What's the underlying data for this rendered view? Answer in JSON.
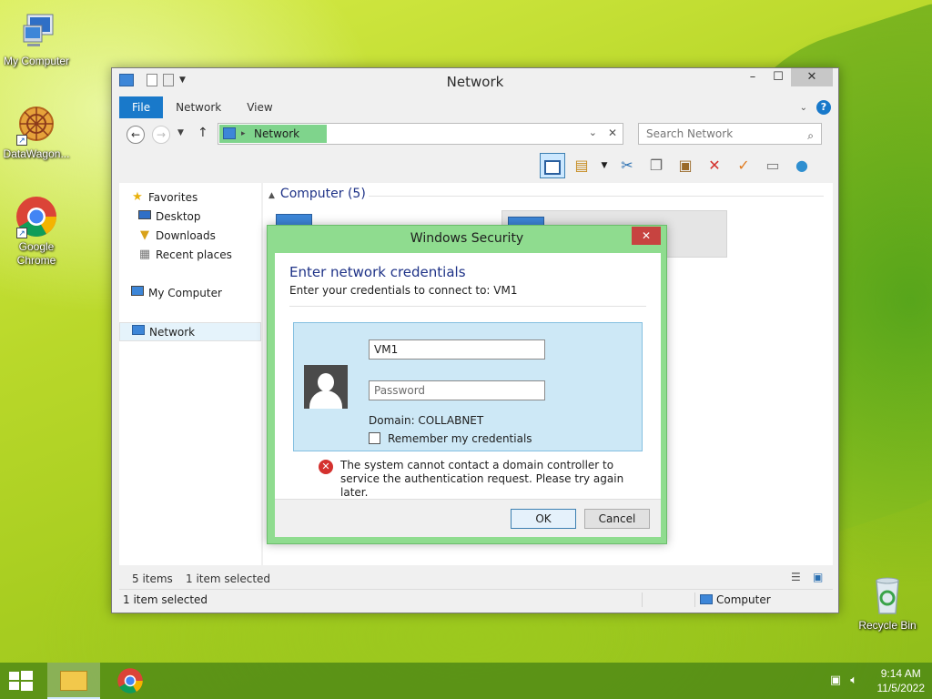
{
  "desktop": {
    "icons": [
      {
        "label": "My Computer"
      },
      {
        "label": "DataWagon..."
      },
      {
        "label": "Google Chrome"
      },
      {
        "label": "Recycle Bin"
      }
    ]
  },
  "explorer": {
    "title": "Network",
    "tabs": {
      "file": "File",
      "network": "Network",
      "view": "View"
    },
    "address_crumb": "Network",
    "search_placeholder": "Search Network",
    "nav": {
      "favorites": "Favorites",
      "desktop": "Desktop",
      "downloads": "Downloads",
      "recent": "Recent places",
      "my_computer": "My Computer",
      "network": "Network"
    },
    "group_header": "Computer (5)",
    "status_items": "5 items",
    "status_selected": "1 item selected",
    "bottom_status": "1 item selected",
    "bottom_location": "Computer"
  },
  "dialog": {
    "title": "Windows Security",
    "heading": "Enter network credentials",
    "subheading": "Enter your credentials to connect to: VM1",
    "username_value": "VM1",
    "password_placeholder": "Password",
    "domain_text": "Domain: COLLABNET",
    "remember_label": "Remember my credentials",
    "error_text": "The system cannot contact a domain controller to service the authentication request. Please try again later.",
    "ok_label": "OK",
    "cancel_label": "Cancel"
  },
  "taskbar": {
    "time": "9:14 AM",
    "date": "11/5/2022"
  },
  "colors": {
    "accent": "#1979ca",
    "dialog_frame": "#8fdc8f",
    "credential_panel": "#cde8f6",
    "close_button": "#c74340"
  }
}
